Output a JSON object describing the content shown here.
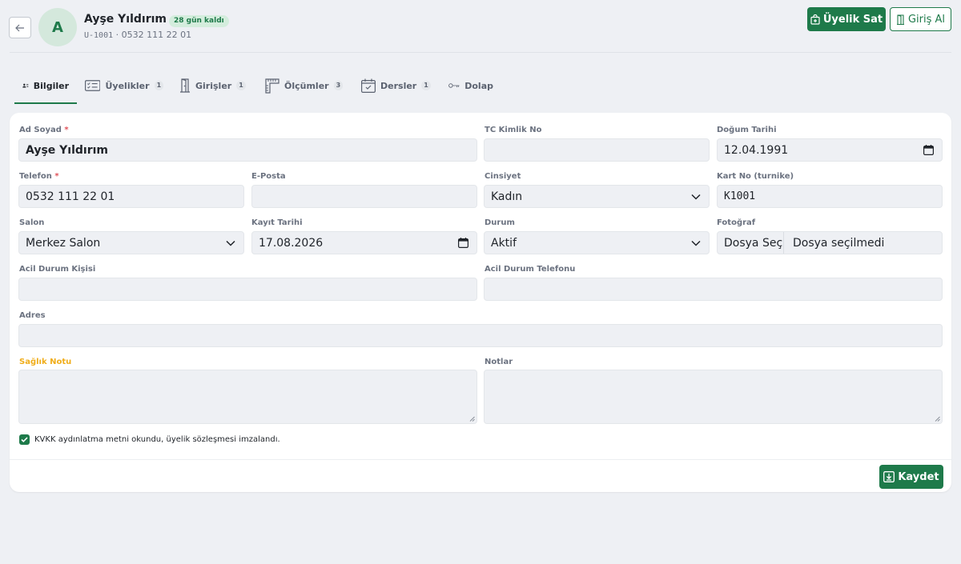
{
  "header": {
    "back_icon": "arrow-left-icon",
    "avatar_initial": "A",
    "name": "Ayşe Yıldırım",
    "badge": "28 gün kaldı",
    "member_code": "U-1001",
    "separator": " · ",
    "phone": "0532 111 22 01",
    "sell_button": "Üyelik Sat",
    "checkin_button": "Giriş Al"
  },
  "tabs": [
    {
      "label": "Bilgiler",
      "count": "",
      "icon": "user-lines-icon"
    },
    {
      "label": "Üyelikler",
      "count": "1",
      "icon": "card-list-icon"
    },
    {
      "label": "Girişler",
      "count": "1",
      "icon": "door-icon"
    },
    {
      "label": "Ölçümler",
      "count": "3",
      "icon": "ruler-icon"
    },
    {
      "label": "Dersler",
      "count": "1",
      "icon": "calendar-check-icon"
    },
    {
      "label": "Dolap",
      "count": "",
      "icon": "key-icon"
    }
  ],
  "form": {
    "full_name": {
      "label": "Ad Soyad",
      "required": "*",
      "value": "Ayşe Yıldırım"
    },
    "tc_no": {
      "label": "TC Kimlik No",
      "value": ""
    },
    "birth_date": {
      "label": "Doğum Tarihi",
      "value": "12.04.1991"
    },
    "phone": {
      "label": "Telefon",
      "required": "*",
      "value": "0532 111 22 01"
    },
    "email": {
      "label": "E-Posta",
      "value": ""
    },
    "gender": {
      "label": "Cinsiyet",
      "value": "Kadın"
    },
    "card_no": {
      "label": "Kart No (turnike)",
      "value": "K1001"
    },
    "salon": {
      "label": "Salon",
      "value": "Merkez Salon"
    },
    "register_date": {
      "label": "Kayıt Tarihi",
      "value": "17.08.2026"
    },
    "status": {
      "label": "Durum",
      "value": "Aktif"
    },
    "photo": {
      "label": "Fotoğraf",
      "button": "Dosya Seç",
      "status": "Dosya seçilmedi"
    },
    "emergency_person": {
      "label": "Acil Durum Kişisi",
      "value": ""
    },
    "emergency_phone": {
      "label": "Acil Durum Telefonu",
      "value": ""
    },
    "address": {
      "label": "Adres",
      "value": ""
    },
    "health_note": {
      "label": "Sağlık Notu",
      "value": ""
    },
    "notes": {
      "label": "Notlar",
      "value": ""
    },
    "kvkk_text": "KVKK aydınlatma metni okundu, üyelik sözleşmesi imzalandı.",
    "kvkk_checked": true,
    "save_button": "Kaydet"
  },
  "colors": {
    "accent": "#1e7a4a",
    "required": "#e0525a",
    "warning_label": "#f0ad1a",
    "field_bg": "#eef0f4"
  }
}
